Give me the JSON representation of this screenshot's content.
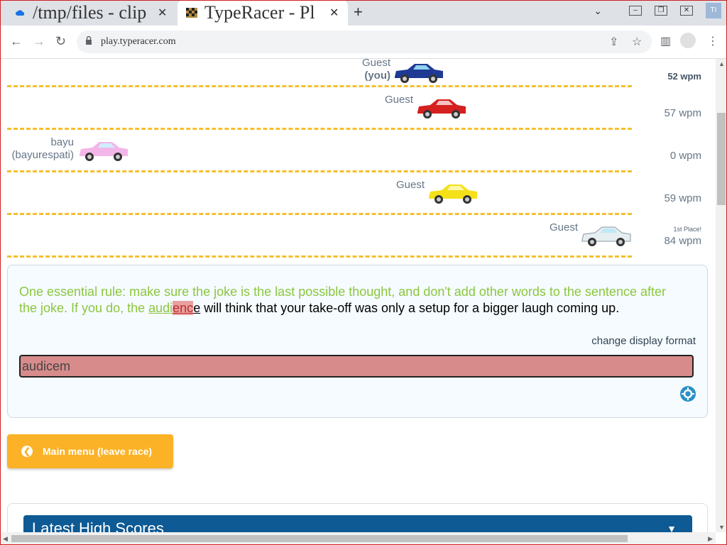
{
  "browser": {
    "tabs": [
      {
        "title": "/tmp/files - clip"
      },
      {
        "title": "TypeRacer - Pl"
      }
    ],
    "new_tab": "+",
    "close": "✕",
    "url": "play.typeracer.com",
    "corner_badge": "TI"
  },
  "race": {
    "lanes": [
      {
        "name": "Guest",
        "sub": "(you)",
        "wpm": "52 wpm",
        "car_color": "#1f3a93"
      },
      {
        "name": "Guest",
        "sub": "",
        "wpm": "57 wpm",
        "car_color": "#d61f1f"
      },
      {
        "name": "bayu",
        "sub": "(bayurespati)",
        "wpm": "0 wpm",
        "car_color": "#f3b6e8"
      },
      {
        "name": "Guest",
        "sub": "",
        "wpm": "59 wpm",
        "car_color": "#f4e11a"
      },
      {
        "name": "Guest",
        "sub": "",
        "wpm": "84 wpm",
        "place": "1st Place!",
        "car_color": "#e6eef2"
      }
    ]
  },
  "typing": {
    "typed_text": "One essential rule: make sure the joke is the last possible thought, and don't add other words to the sentence after the joke. If you do, the ",
    "word_done": "audi",
    "word_error": "enc",
    "word_rest": "e",
    "remaining_text": " will think that your take-off was only a setup for a bigger laugh coming up.",
    "change_format": "change display format",
    "input_value": "audicem"
  },
  "menu_button": {
    "label": "Main menu (leave race)"
  },
  "high_scores": {
    "title": "Latest High Scores"
  }
}
